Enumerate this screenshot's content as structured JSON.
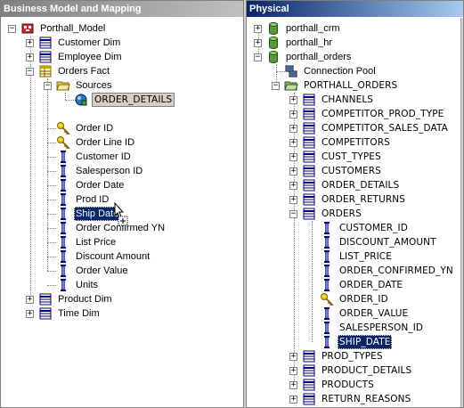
{
  "left_pane": {
    "title": "Business Model and Mapping",
    "tree": {
      "model": "Porthall_Model",
      "customer_dim": "Customer Dim",
      "employee_dim": "Employee Dim",
      "orders_fact": "Orders Fact",
      "sources": "Sources",
      "order_details_source": "ORDER_DETAILS",
      "columns": {
        "order_id": "Order ID",
        "order_line_id": "Order Line ID",
        "customer_id": "Customer ID",
        "salesperson_id": "Salesperson ID",
        "order_date": "Order Date",
        "prod_id": "Prod ID",
        "ship_date": "Ship Date",
        "order_confirmed_yn": "Order Confirmed YN",
        "list_price": "List Price",
        "discount_amount": "Discount Amount",
        "order_value": "Order Value",
        "units": "Units"
      },
      "product_dim": "Product Dim",
      "time_dim": "Time Dim"
    }
  },
  "right_pane": {
    "title": "Physical",
    "tree": {
      "db_crm": "porthall_crm",
      "db_hr": "porthall_hr",
      "db_orders": "porthall_orders",
      "connection_pool": "Connection Pool",
      "schema": "PORTHALL_ORDERS",
      "tables_before": [
        "CHANNELS",
        "COMPETITOR_PROD_TYPE",
        "COMPETITOR_SALES_DATA",
        "COMPETITORS",
        "CUST_TYPES",
        "CUSTOMERS",
        "ORDER_DETAILS",
        "ORDER_RETURNS"
      ],
      "orders_table": "ORDERS",
      "orders_columns": {
        "customer_id": "CUSTOMER_ID",
        "discount_amount": "DISCOUNT_AMOUNT",
        "list_price": "LIST_PRICE",
        "order_confirmed_yn": "ORDER_CONFIRMED_YN",
        "order_date": "ORDER_DATE",
        "order_id": "ORDER_ID",
        "order_value": "ORDER_VALUE",
        "salesperson_id": "SALESPERSON_ID",
        "ship_date": "SHIP_DATE"
      },
      "tables_after": [
        "PROD_TYPES",
        "PRODUCT_DETAILS",
        "PRODUCTS",
        "RETURN_REASONS"
      ]
    }
  },
  "colors": {
    "selection": "#0a246a",
    "key_icon": "#d4b000",
    "table_icon": "#000080",
    "db_icon": "#5a9a3a",
    "folder_icon": "#e8d070",
    "model_icon": "#c03030"
  }
}
